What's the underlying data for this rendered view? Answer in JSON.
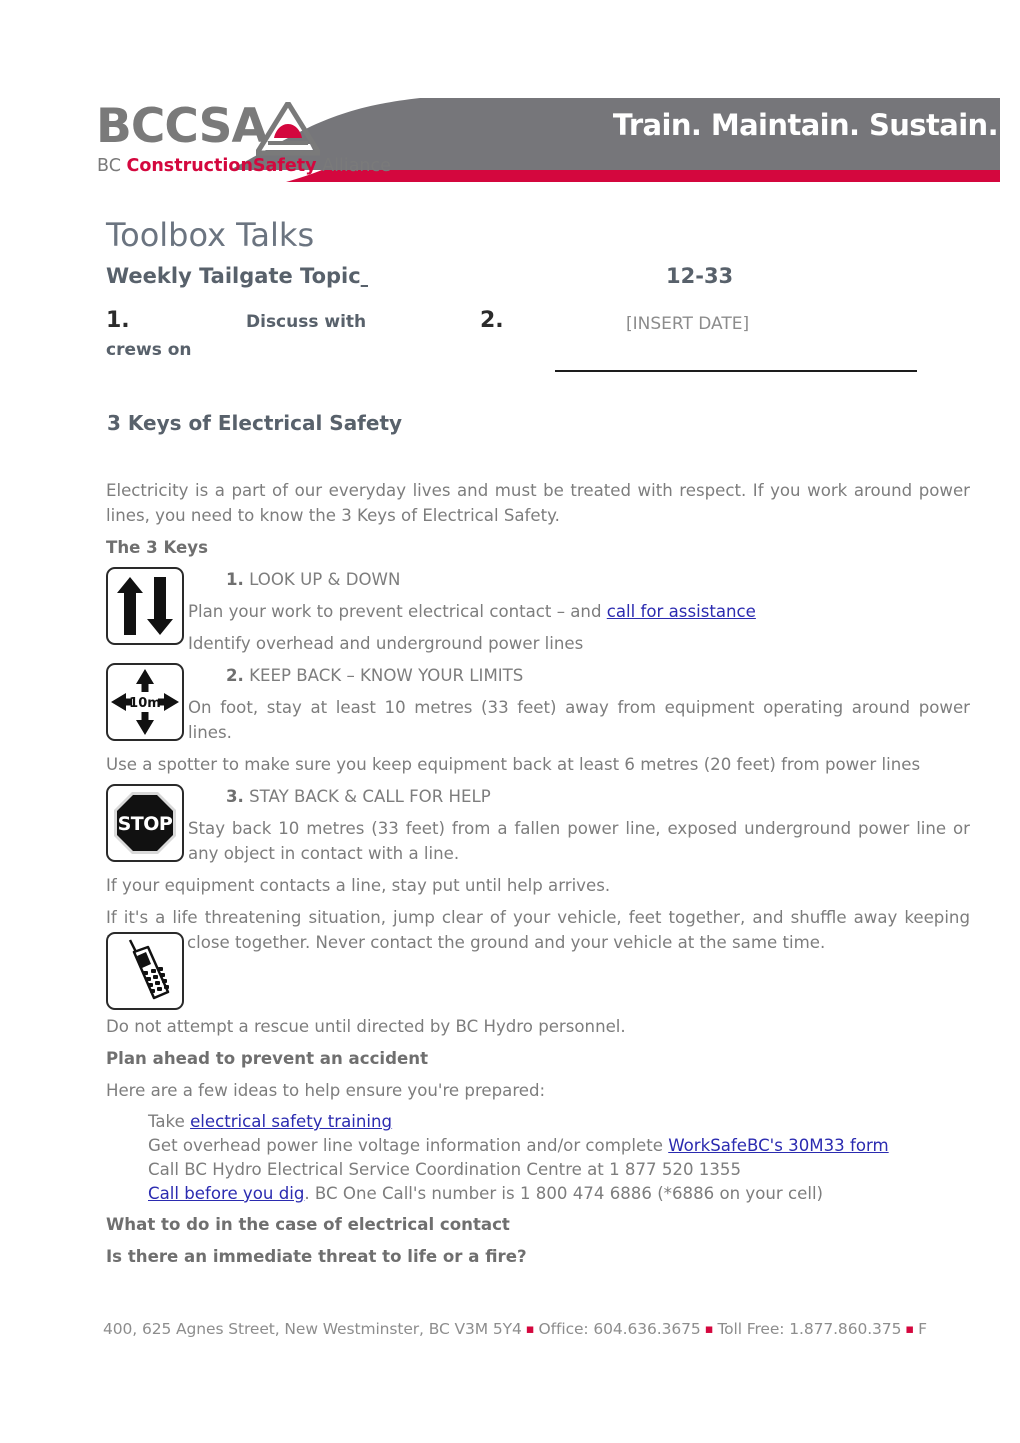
{
  "header": {
    "logo_wordmark": "BCCSA",
    "logo_tagline_1": "BC ",
    "logo_tagline_2": "ConstructionSafety",
    "logo_tagline_3": " Alliance",
    "slogan": "Train. Maintain. Sustain.",
    "colors": {
      "banner_grey": "#76767a",
      "banner_red": "#d4073e",
      "logo_grey": "#7a7a7a",
      "logo_red": "#d4073e"
    }
  },
  "document": {
    "title": "Toolbox Talks",
    "subtitle_left": "Weekly Tailgate Topic",
    "topic_number": "12-33",
    "step1_number": "1.",
    "step1_text": "Discuss with",
    "step1_text_cont": "crews on",
    "step2_number": "2.",
    "date_placeholder": "[INSERT DATE]",
    "section_heading": "3 Keys of Electrical Safety",
    "intro": "Electricity is a part of our everyday lives and must be treated with respect. If you work around power lines, you need to know the 3 Keys of Electrical Safety.",
    "keys_heading": "The 3 Keys",
    "key1": {
      "icon": "up-down-arrows-icon",
      "number": "1.",
      "title": "LOOK UP & DOWN",
      "line1_pre": "Plan your work to prevent electrical contact – and ",
      "line1_link": "call for assistance",
      "line2": "Identify overhead and underground power lines"
    },
    "key2": {
      "icon": "ten-metre-clearance-icon",
      "icon_label": "10m",
      "number": "2.",
      "title": "KEEP BACK – KNOW YOUR LIMITS",
      "line1": "On foot, stay at least 10 metres (33 feet) away from equipment operating around power lines.",
      "line2": "Use a spotter to make sure you keep equipment back at least 6 metres (20 feet) from power lines"
    },
    "key3": {
      "icon": "stop-sign-icon",
      "icon_label": "STOP",
      "number": "3.",
      "title": "STAY BACK & CALL FOR HELP",
      "line1": "Stay back 10 metres (33 feet) from a fallen power line, exposed underground power line or any object in contact with a line.",
      "line2": "If your equipment contacts a line, stay put until help arrives.",
      "line3": "If it's a life threatening situation, jump clear of your vehicle, feet together, and shuffle away keeping both feet close together. Never contact the ground and your vehicle at the same time."
    },
    "phone_section": {
      "icon": "mobile-phone-icon",
      "text": "Do not attempt a rescue until directed by BC Hydro personnel."
    },
    "plan_heading": "Plan ahead to prevent an accident",
    "plan_intro": "Here are a few ideas to help ensure you're prepared:",
    "ideas": [
      {
        "pre": "Take ",
        "link": "electrical safety training",
        "post": ""
      },
      {
        "pre": "Get overhead power line voltage information and/or complete ",
        "link": "WorkSafeBC's 30M33 form",
        "post": ""
      },
      {
        "pre": "Call BC Hydro Electrical Service Coordination Centre at 1 877 520 1355",
        "link": "",
        "post": ""
      },
      {
        "pre": "",
        "link": "Call before you dig",
        "post": ". BC One Call's number is 1 800 474 6886 (*6886 on your cell)"
      }
    ],
    "contact_heading": "What to do in the case of electrical contact",
    "threat_heading": "Is there an immediate threat to life or a fire?"
  },
  "footer": {
    "address": "400, 625 Agnes Street, New Westminster, BC V3M 5Y4",
    "office": "Office: 604.636.3675",
    "toll_free": "Toll Free: 1.877.860.375",
    "trailing": "F"
  }
}
